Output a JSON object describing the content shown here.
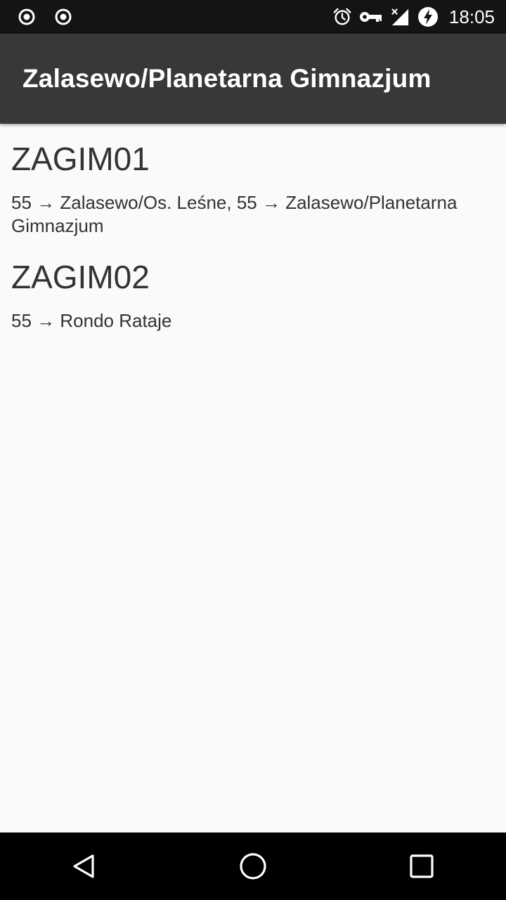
{
  "status_bar": {
    "left_icons": [
      "record-icon",
      "record-icon"
    ],
    "right_icons": [
      "alarm-icon",
      "key-icon",
      "signal-off-icon",
      "battery-charging-icon"
    ],
    "time": "18:05"
  },
  "app_bar": {
    "title": "Zalasewo/Planetarna Gimnazjum"
  },
  "stops": [
    {
      "code": "ZAGIM01",
      "lines": "55 → Zalasewo/Os. Leśne, 55 → Zalasewo/Planetarna Gimnazjum"
    },
    {
      "code": "ZAGIM02",
      "lines": "55 → Rondo Rataje"
    }
  ],
  "nav_bar": {
    "buttons": [
      "back-icon",
      "home-icon",
      "recents-icon"
    ]
  },
  "colors": {
    "status_bar": "#141414",
    "app_bar": "#383838",
    "background": "#fafafa",
    "text": "#333333"
  }
}
